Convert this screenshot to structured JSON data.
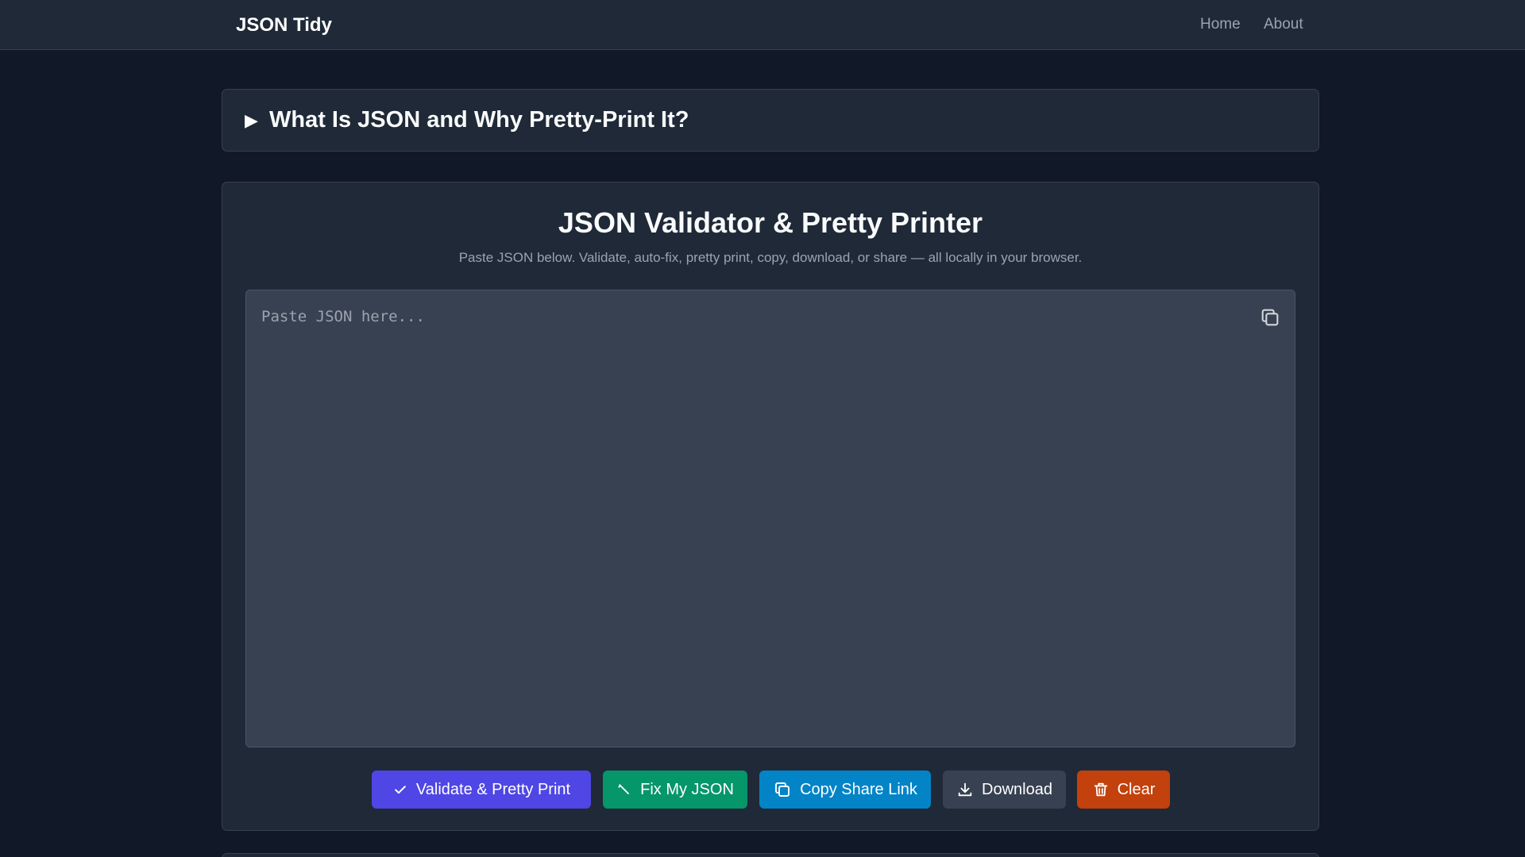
{
  "nav": {
    "brand": "JSON Tidy",
    "links": [
      {
        "label": "Home"
      },
      {
        "label": "About"
      }
    ]
  },
  "faq": {
    "arrow": "▶",
    "title": "What Is JSON and Why Pretty-Print It?"
  },
  "tool": {
    "title": "JSON Validator & Pretty Printer",
    "subtitle": "Paste JSON below. Validate, auto-fix, pretty print, copy, download, or share — all locally in your browser.",
    "editor_value": "",
    "editor_placeholder": "Paste JSON here...",
    "copy_icon": "copy-icon",
    "buttons": [
      {
        "label": "Validate & Pretty Print",
        "icon": "check-icon",
        "color": "#4f46e5"
      },
      {
        "label": "Fix My JSON",
        "icon": "wrench-icon",
        "color": "#059669"
      },
      {
        "label": "Copy Share Link",
        "icon": "copy-icon",
        "color": "#0284c7"
      },
      {
        "label": "Download",
        "icon": "download-icon",
        "color": "#374151"
      },
      {
        "label": "Clear",
        "icon": "trash-icon",
        "color": "#c2410c"
      }
    ]
  },
  "colors": {
    "page_bg": "#111827",
    "panel_bg": "#1f2937",
    "editor_bg": "#374151"
  }
}
